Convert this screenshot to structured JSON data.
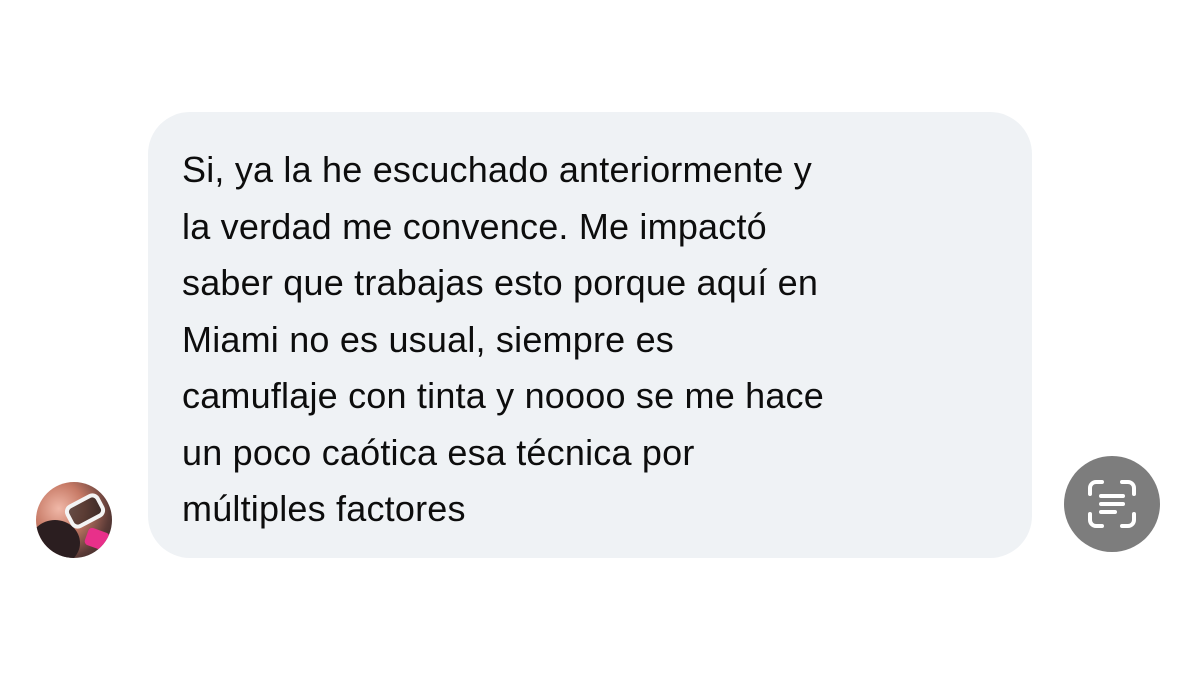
{
  "message": {
    "text": "Si, ya la he escuchado anteriormente y\nla verdad me convence. Me impactó\nsaber que trabajas esto porque aquí en\nMiami no es usual, siempre es\ncamuflaje con tinta y noooo se me hace\nun poco caótica esa técnica por\nmúltiples factores",
    "bubble_color": "#eff2f5",
    "text_color": "#0d0d0d"
  },
  "sender": {
    "avatar_icon": "profile-photo"
  },
  "actions": {
    "scan_icon": "text-scan-icon",
    "scan_button_color": "#7d7d7d"
  }
}
